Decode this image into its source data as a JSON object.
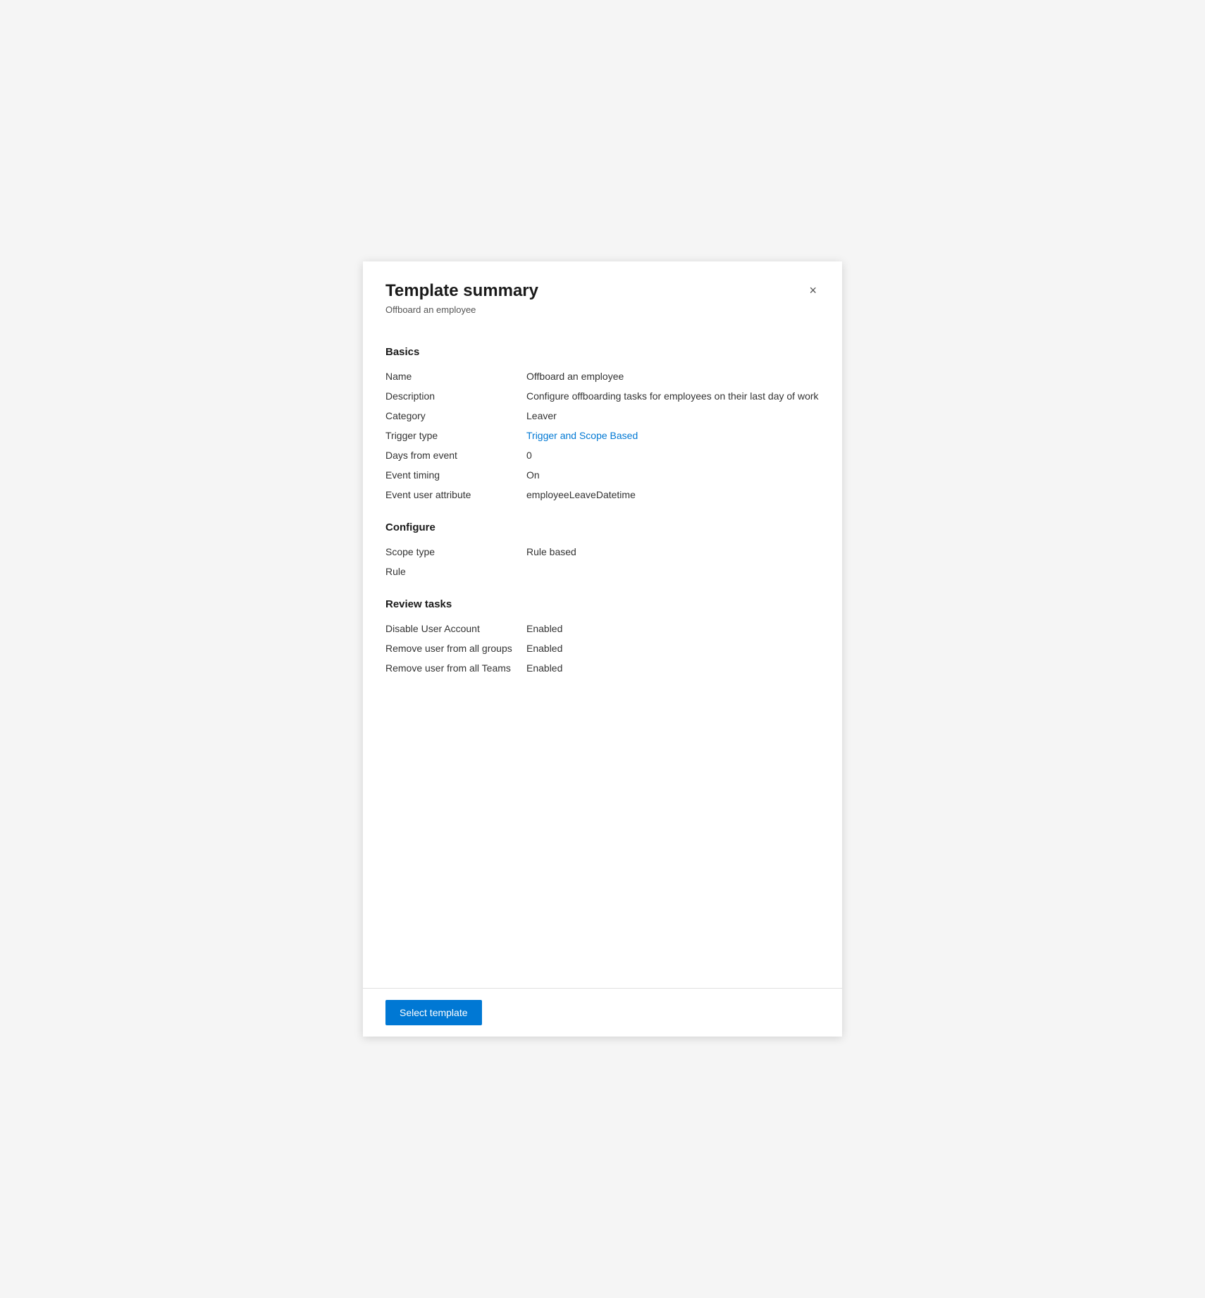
{
  "panel": {
    "title": "Template summary",
    "subtitle": "Offboard an employee",
    "close_label": "×"
  },
  "sections": {
    "basics": {
      "heading": "Basics",
      "fields": [
        {
          "label": "Name",
          "value": "Offboard an employee",
          "link": false
        },
        {
          "label": "Description",
          "value": "Configure offboarding tasks for employees on their last day of work",
          "link": false
        },
        {
          "label": "Category",
          "value": "Leaver",
          "link": false
        },
        {
          "label": "Trigger type",
          "value": "Trigger and Scope Based",
          "link": true
        },
        {
          "label": "Days from event",
          "value": "0",
          "link": false
        },
        {
          "label": "Event timing",
          "value": "On",
          "link": false
        },
        {
          "label": "Event user attribute",
          "value": "employeeLeaveDatetime",
          "link": false
        }
      ]
    },
    "configure": {
      "heading": "Configure",
      "fields": [
        {
          "label": "Scope type",
          "value": "Rule based",
          "link": false
        },
        {
          "label": "Rule",
          "value": "",
          "link": false
        }
      ]
    },
    "review_tasks": {
      "heading": "Review tasks",
      "fields": [
        {
          "label": "Disable User Account",
          "value": "Enabled",
          "link": true
        },
        {
          "label": "Remove user from all groups",
          "value": "Enabled",
          "link": true
        },
        {
          "label": "Remove user from all Teams",
          "value": "Enabled",
          "link": true
        }
      ]
    }
  },
  "footer": {
    "select_template_label": "Select template"
  }
}
